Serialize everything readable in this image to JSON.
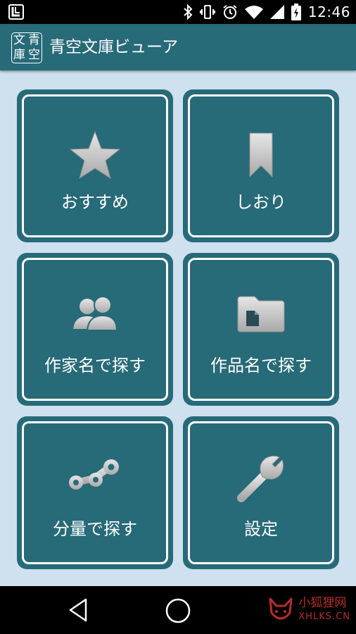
{
  "status_bar": {
    "time": "12:46",
    "icons": [
      "bluetooth-icon",
      "vibrate-icon",
      "alarm-icon",
      "wifi-icon",
      "signal-icon",
      "battery-icon"
    ]
  },
  "app_bar": {
    "title": "青空文庫ビューア",
    "logo_chars": [
      "文",
      "青",
      "庫",
      "空"
    ]
  },
  "tiles": [
    {
      "label": "おすすめ",
      "icon": "star-icon"
    },
    {
      "label": "しおり",
      "icon": "bookmark-icon"
    },
    {
      "label": "作家名で探す",
      "icon": "people-icon"
    },
    {
      "label": "作品名で探す",
      "icon": "folder-icon"
    },
    {
      "label": "分量で探す",
      "icon": "path-icon"
    },
    {
      "label": "設定",
      "icon": "wrench-icon"
    }
  ],
  "nav_bar": {
    "buttons": [
      "back-icon",
      "home-icon"
    ]
  },
  "watermark": {
    "line1": "小狐狸网",
    "line2": "XHLKS.CN"
  },
  "colors": {
    "primary": "#276a78",
    "background": "#cfe0ee",
    "icon_gray": "#c9c9c9"
  }
}
